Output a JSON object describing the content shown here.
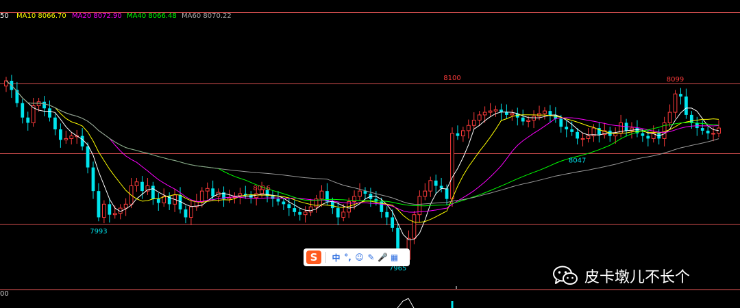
{
  "legend": {
    "ma5_partial": "50",
    "ma10": "MA10 8066.70",
    "ma20": "MA20 8072.90",
    "ma40": "MA40 8066.48",
    "ma60": "MA60 8070.22"
  },
  "colors": {
    "up": "#ff3b3b",
    "down": "#00e5ee",
    "ma5": "#ffffff",
    "ma10": "#ffff00",
    "ma20": "#ff00ff",
    "ma40": "#00ff00",
    "ma60": "#9a9a9a",
    "hline": "#ff6060"
  },
  "subpanel": {
    "label_partial": "00"
  },
  "ime_toolbar": {
    "logo": "S",
    "items": [
      "中",
      "°,",
      "☺",
      "✎",
      "🎤",
      "▦"
    ]
  },
  "watermark": {
    "text": "皮卡墩儿不长个",
    "icon": "wechat-icon"
  },
  "chart_data": {
    "type": "candlestick",
    "ylim": [
      7955,
      8114
    ],
    "horizontal_lines": [
      8100,
      8047,
      7993
    ],
    "annotations": [
      {
        "text": "8100",
        "value": 8100,
        "index": 82,
        "pos": "above"
      },
      {
        "text": "8099",
        "value": 8099,
        "index": 123,
        "pos": "above"
      },
      {
        "text": "8016",
        "value": 8016,
        "index": 47,
        "pos": "above"
      },
      {
        "text": "8047",
        "value": 8047,
        "index": 105,
        "pos": "below"
      },
      {
        "text": "7993",
        "value": 7993,
        "index": 17,
        "pos": "below"
      },
      {
        "text": "7965",
        "value": 7965,
        "index": 72,
        "pos": "below"
      }
    ],
    "closes": [
      8102,
      8095,
      8085,
      8074,
      8070,
      8083,
      8086,
      8081,
      8074,
      8065,
      8057,
      8058,
      8060,
      8060,
      8052,
      8036,
      8018,
      7998,
      8008,
      8000,
      8001,
      8005,
      8008,
      8022,
      8025,
      8018,
      8022,
      8012,
      8009,
      8014,
      8008,
      8015,
      8004,
      7998,
      8006,
      8010,
      8018,
      8020,
      8014,
      8017,
      8012,
      8013,
      8014,
      8016,
      8015,
      8013,
      8016,
      8019,
      8014,
      8012,
      8010,
      8008,
      8005,
      8002,
      8000,
      8002,
      8006,
      8012,
      8018,
      8010,
      8005,
      7998,
      8002,
      8010,
      8014,
      8018,
      8016,
      8012,
      8010,
      8002,
      7998,
      7990,
      7968,
      7966,
      7982,
      8000,
      8014,
      8018,
      8026,
      8022,
      8020,
      8012,
      8062,
      8060,
      8064,
      8068,
      8072,
      8076,
      8078,
      8079,
      8080,
      8078,
      8076,
      8077,
      8074,
      8071,
      8072,
      8075,
      8077,
      8079,
      8076,
      8073,
      8067,
      8065,
      8063,
      8058,
      8058,
      8060,
      8066,
      8061,
      8064,
      8060,
      8062,
      8070,
      8064,
      8066,
      8062,
      8060,
      8058,
      8062,
      8058,
      8070,
      8078,
      8092,
      8090,
      8076,
      8070,
      8066,
      8064,
      8062,
      8062,
      8066
    ]
  }
}
